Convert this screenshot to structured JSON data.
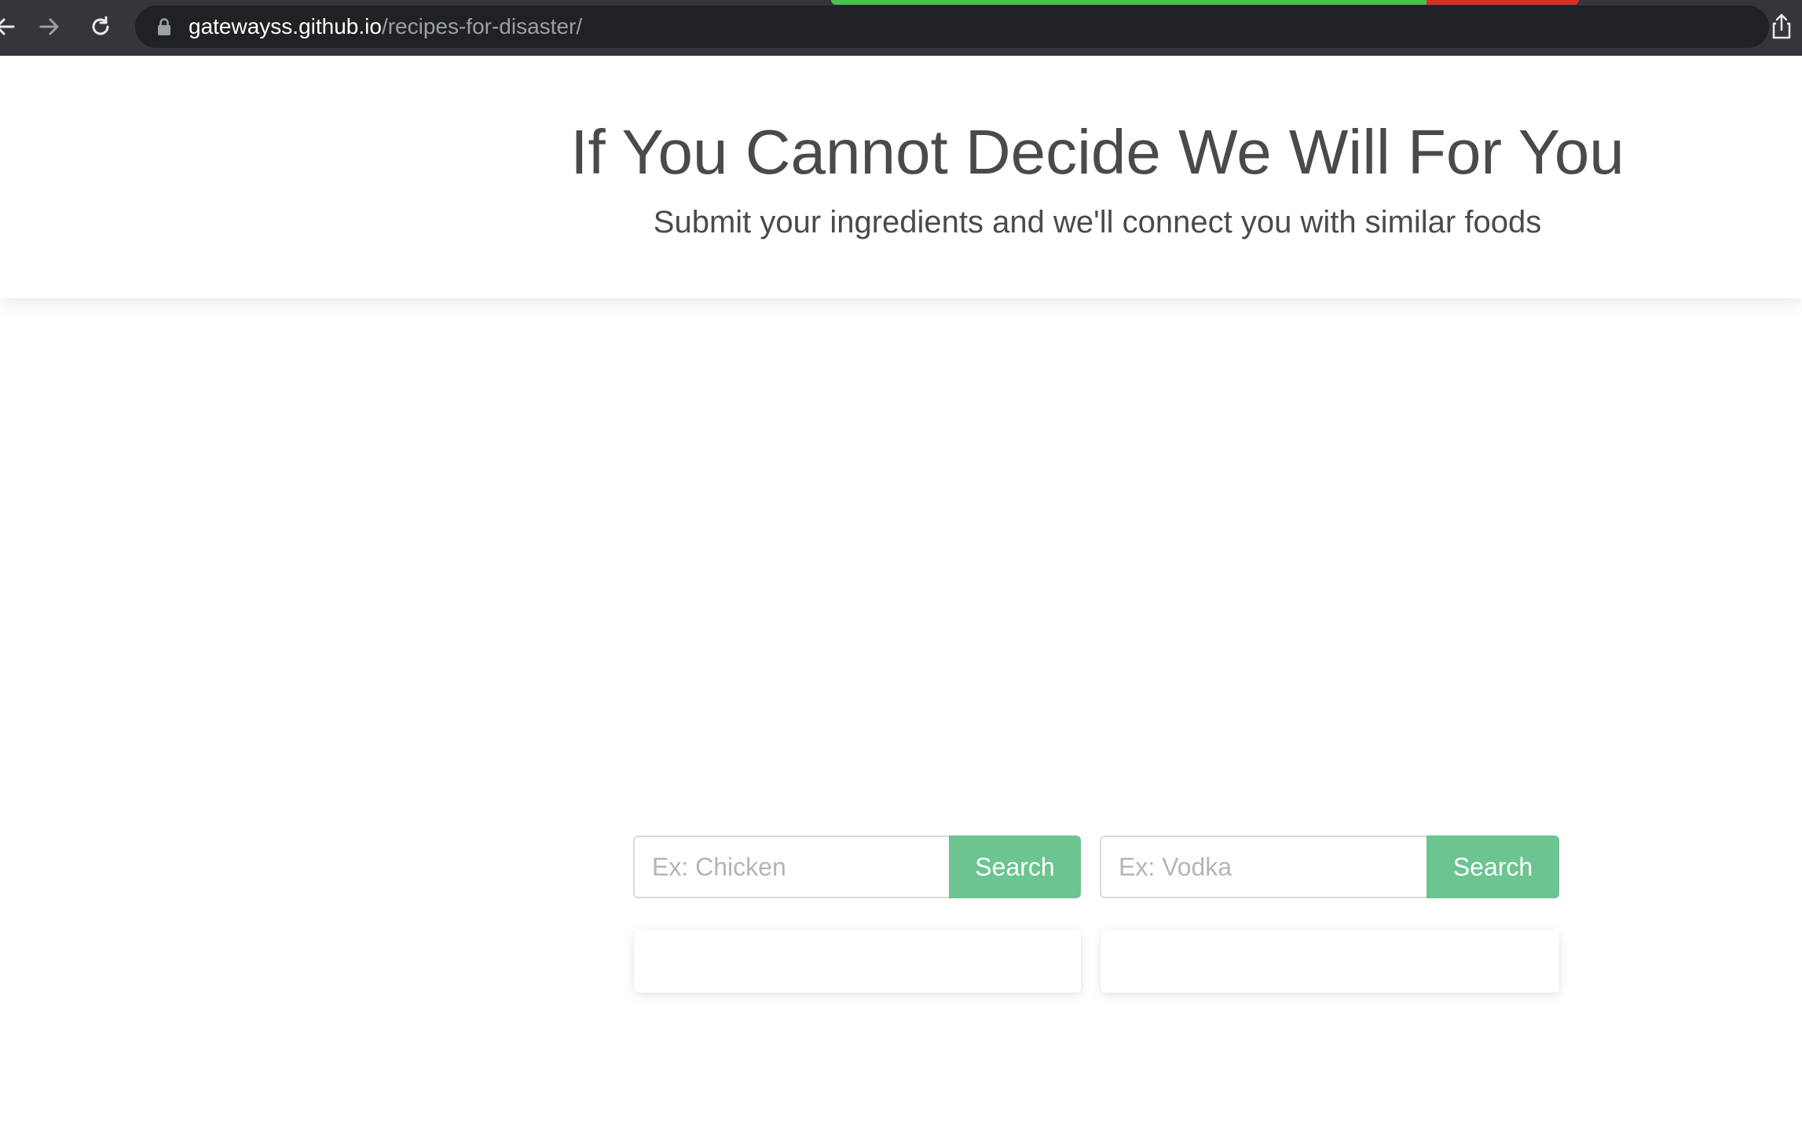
{
  "browser": {
    "url_host": "gatewayss.github.io",
    "url_path": "/recipes-for-disaster/",
    "icons": [
      "back-icon",
      "forward-icon",
      "reload-icon",
      "lock-icon",
      "share-icon"
    ]
  },
  "hero": {
    "title": "If You Cannot Decide We Will For You",
    "subtitle": "Submit your ingredients and we'll connect you with similar foods"
  },
  "food_search": {
    "placeholder": "Ex: Chicken",
    "value": "",
    "button_label": "Search"
  },
  "drink_search": {
    "placeholder": "Ex: Vodka",
    "value": "",
    "button_label": "Search"
  },
  "colors": {
    "accent": "#6cc490",
    "text": "#4a4a4a",
    "chrome": "#35363a"
  }
}
